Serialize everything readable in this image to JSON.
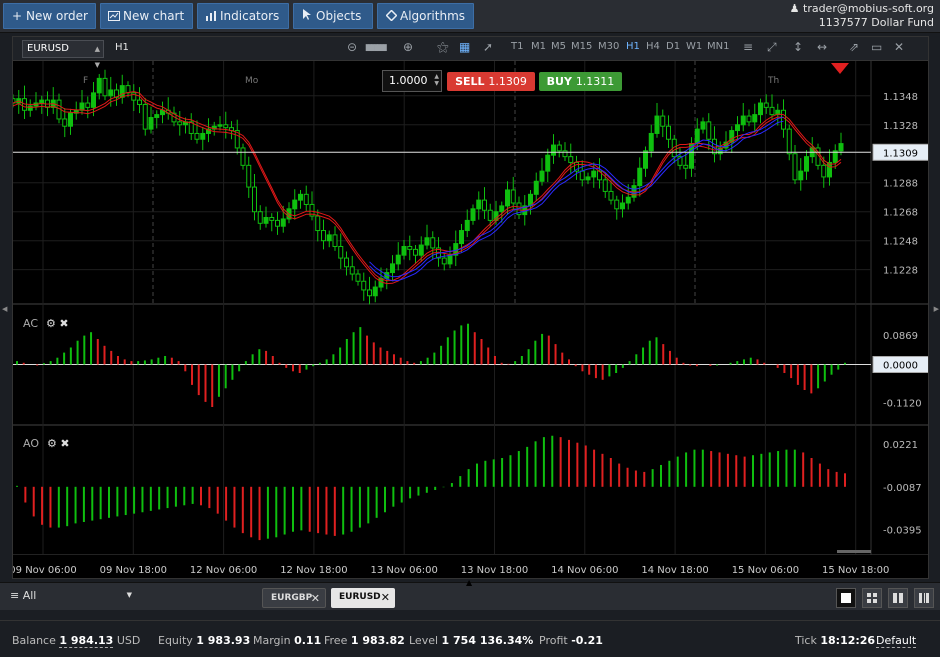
{
  "toolbar": {
    "new_order": "New order",
    "new_chart": "New chart",
    "indicators": "Indicators",
    "objects": "Objects",
    "algorithms": "Algorithms"
  },
  "account": {
    "user": "trader@mobius-soft.org",
    "id_fund": "1137577 Dollar Fund"
  },
  "chart_header": {
    "symbol": "EURUSD",
    "timeframe": "H1",
    "timeframes": [
      "T1",
      "M1",
      "M5",
      "M15",
      "M30",
      "H1",
      "H4",
      "D1",
      "W1",
      "MN1"
    ],
    "active_timeframe": "H1"
  },
  "trade": {
    "quantity": "1.0000",
    "sell_label": "SELL",
    "sell_price": "1.1309",
    "buy_label": "BUY",
    "buy_price": "1.1311"
  },
  "colors": {
    "bull": "#0fbf0f",
    "bear": "#e02020",
    "ma_red": "#e01818",
    "ma_blue": "#2a2aff",
    "accent": "#2f5a8a"
  },
  "chart_data": [
    {
      "type": "candlestick",
      "name": "EURUSD H1",
      "y_axis_labels": [
        "1.1348",
        "1.1328",
        "1.1309",
        "1.1288",
        "1.1268",
        "1.1248",
        "1.1228"
      ],
      "ylim": [
        1.1205,
        1.1372
      ],
      "current_price": "1.1309",
      "day_labels": [
        "F",
        "Mo",
        "Th"
      ],
      "x_tick_labels": [
        "09 Nov 06:00",
        "09 Nov 18:00",
        "12 Nov 06:00",
        "12 Nov 18:00",
        "13 Nov 06:00",
        "13 Nov 18:00",
        "14 Nov 06:00",
        "14 Nov 18:00",
        "15 Nov 06:00",
        "15 Nov 18:00"
      ],
      "close": [
        1.1343,
        1.1346,
        1.1338,
        1.1341,
        1.1343,
        1.1345,
        1.134,
        1.1345,
        1.1332,
        1.1327,
        1.1336,
        1.1338,
        1.1343,
        1.134,
        1.135,
        1.136,
        1.1348,
        1.1352,
        1.1347,
        1.1355,
        1.135,
        1.1345,
        1.1342,
        1.1325,
        1.1333,
        1.1335,
        1.1338,
        1.1336,
        1.133,
        1.1328,
        1.133,
        1.1322,
        1.1318,
        1.1322,
        1.1325,
        1.1327,
        1.1328,
        1.1326,
        1.1324,
        1.1312,
        1.13,
        1.1285,
        1.1268,
        1.126,
        1.1264,
        1.1262,
        1.1258,
        1.1263,
        1.127,
        1.1276,
        1.128,
        1.1273,
        1.1265,
        1.1255,
        1.1248,
        1.1252,
        1.1244,
        1.1236,
        1.123,
        1.1225,
        1.122,
        1.1214,
        1.121,
        1.1216,
        1.1222,
        1.1226,
        1.1232,
        1.1238,
        1.1244,
        1.1242,
        1.1238,
        1.1245,
        1.125,
        1.1243,
        1.1236,
        1.1232,
        1.1238,
        1.1246,
        1.1255,
        1.1262,
        1.127,
        1.1276,
        1.1269,
        1.1262,
        1.1268,
        1.1272,
        1.1283,
        1.1274,
        1.1266,
        1.1272,
        1.128,
        1.1289,
        1.1296,
        1.1307,
        1.1314,
        1.131,
        1.1306,
        1.1302,
        1.1296,
        1.129,
        1.1292,
        1.1296,
        1.129,
        1.1282,
        1.1276,
        1.127,
        1.1274,
        1.1278,
        1.1286,
        1.1298,
        1.131,
        1.1322,
        1.1334,
        1.1327,
        1.1318,
        1.1306,
        1.13,
        1.1298,
        1.1315,
        1.1325,
        1.133,
        1.1318,
        1.1308,
        1.1312,
        1.1316,
        1.1324,
        1.1328,
        1.1334,
        1.133,
        1.1335,
        1.1343,
        1.134,
        1.1335,
        1.1338,
        1.1325,
        1.1308,
        1.129,
        1.1296,
        1.1306,
        1.1312,
        1.13,
        1.1292,
        1.1302,
        1.131,
        1.1315
      ],
      "series": [
        {
          "name": "MA red",
          "color": "#e01818"
        },
        {
          "name": "MA blue",
          "color": "#2a2aff"
        }
      ]
    },
    {
      "type": "histogram",
      "name": "AC",
      "y_axis_labels": [
        "0.0869",
        "0.0000",
        "-0.1120"
      ],
      "ylim": [
        -0.175,
        0.175
      ],
      "values": [
        0.01,
        0.005,
        0.0,
        -0.003,
        0.004,
        0.01,
        0.02,
        0.035,
        0.05,
        0.07,
        0.085,
        0.095,
        0.075,
        0.055,
        0.04,
        0.025,
        0.015,
        0.01,
        0.01,
        0.012,
        0.015,
        0.02,
        0.025,
        0.02,
        0.01,
        -0.02,
        -0.06,
        -0.09,
        -0.11,
        -0.125,
        -0.095,
        -0.07,
        -0.045,
        -0.02,
        0.01,
        0.03,
        0.045,
        0.04,
        0.025,
        0.005,
        -0.01,
        -0.02,
        -0.025,
        -0.015,
        -0.005,
        0.005,
        0.015,
        0.03,
        0.05,
        0.075,
        0.095,
        0.11,
        0.085,
        0.065,
        0.05,
        0.04,
        0.03,
        0.02,
        0.01,
        0.005,
        0.01,
        0.02,
        0.035,
        0.055,
        0.08,
        0.1,
        0.115,
        0.12,
        0.095,
        0.075,
        0.05,
        0.025,
        0.005,
        0.002,
        0.01,
        0.025,
        0.045,
        0.07,
        0.09,
        0.085,
        0.06,
        0.035,
        0.015,
        -0.005,
        -0.02,
        -0.03,
        -0.04,
        -0.045,
        -0.035,
        -0.025,
        -0.01,
        0.01,
        0.03,
        0.05,
        0.07,
        0.08,
        0.06,
        0.04,
        0.02,
        0.005,
        -0.003,
        -0.005,
        0.0,
        -0.004,
        -0.003,
        0.0,
        0.005,
        0.01,
        0.015,
        0.02,
        0.015,
        0.005,
        0.0,
        -0.01,
        -0.025,
        -0.04,
        -0.06,
        -0.075,
        -0.085,
        -0.07,
        -0.05,
        -0.03,
        -0.015,
        0.005
      ],
      "series": [
        {
          "name": "rising",
          "color": "#0fbf0f"
        },
        {
          "name": "falling",
          "color": "#e02020"
        }
      ]
    },
    {
      "type": "histogram",
      "name": "AO",
      "y_axis_labels": [
        "0.0221",
        "-0.0087",
        "-0.0395"
      ],
      "ylim": [
        -0.057,
        0.035
      ],
      "values": [
        -0.008,
        -0.02,
        -0.03,
        -0.036,
        -0.038,
        -0.038,
        -0.037,
        -0.035,
        -0.034,
        -0.033,
        -0.032,
        -0.031,
        -0.03,
        -0.029,
        -0.028,
        -0.027,
        -0.026,
        -0.025,
        -0.024,
        -0.023,
        -0.022,
        -0.021,
        -0.022,
        -0.024,
        -0.028,
        -0.033,
        -0.038,
        -0.042,
        -0.045,
        -0.047,
        -0.046,
        -0.045,
        -0.043,
        -0.041,
        -0.04,
        -0.041,
        -0.042,
        -0.043,
        -0.044,
        -0.043,
        -0.041,
        -0.038,
        -0.035,
        -0.031,
        -0.027,
        -0.023,
        -0.02,
        -0.017,
        -0.015,
        -0.013,
        -0.011,
        -0.009,
        -0.006,
        -0.001,
        0.004,
        0.008,
        0.01,
        0.011,
        0.012,
        0.014,
        0.017,
        0.02,
        0.024,
        0.027,
        0.028,
        0.027,
        0.025,
        0.023,
        0.021,
        0.018,
        0.015,
        0.012,
        0.008,
        0.005,
        0.003,
        0.002,
        0.004,
        0.007,
        0.01,
        0.013,
        0.016,
        0.018,
        0.018,
        0.017,
        0.016,
        0.015,
        0.014,
        0.013,
        0.014,
        0.015,
        0.016,
        0.017,
        0.018,
        0.018,
        0.016,
        0.012,
        0.008,
        0.004,
        0.002,
        0.001
      ],
      "series": [
        {
          "name": "rising",
          "color": "#0fbf0f"
        },
        {
          "name": "falling",
          "color": "#e02020"
        }
      ]
    }
  ],
  "indicators": {
    "ac_label": "AC",
    "ao_label": "AO"
  },
  "bottom": {
    "filter": "All",
    "tabs": [
      {
        "label": "EURGBP",
        "active": false
      },
      {
        "label": "EURUSD",
        "active": true
      }
    ]
  },
  "status": {
    "balance_label": "Balance",
    "balance": "1 984.13",
    "balance_ccy": "USD",
    "equity_label": "Equity",
    "equity": "1 983.93",
    "margin_label": "Margin",
    "margin": "0.11",
    "free_label": "Free",
    "free": "1 983.82",
    "level_label": "Level",
    "level": "1 754 136.34%",
    "profit_label": "Profit",
    "profit": "-0.21",
    "tick_label": "Tick",
    "tick": "18:12:26",
    "profile": "Default"
  }
}
